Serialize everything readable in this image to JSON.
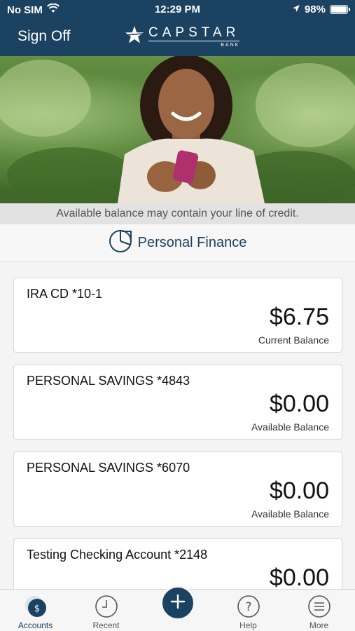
{
  "status_bar": {
    "carrier": "No SIM",
    "time": "12:29 PM",
    "battery": "98%",
    "battery_level": 0.98
  },
  "header": {
    "sign_off": "Sign Off",
    "logo_name": "CAPSTAR",
    "logo_sub": "BANK"
  },
  "notice": "Available balance may contain your line of credit.",
  "personal_finance": {
    "label": "Personal Finance"
  },
  "accounts": [
    {
      "name": "IRA CD *10-1",
      "amount": "$6.75",
      "caption": "Current Balance"
    },
    {
      "name": "PERSONAL SAVINGS *4843",
      "amount": "$0.00",
      "caption": "Available Balance"
    },
    {
      "name": "PERSONAL SAVINGS *6070",
      "amount": "$0.00",
      "caption": "Available Balance"
    },
    {
      "name": "Testing Checking Account *2148",
      "amount": "$0.00",
      "caption": ""
    }
  ],
  "tabbar": {
    "accounts": "Accounts",
    "recent": "Recent",
    "help": "Help",
    "more": "More",
    "active": "accounts"
  },
  "colors": {
    "brand": "#1c4261",
    "background": "#f4f4f4",
    "card": "#ffffff"
  }
}
